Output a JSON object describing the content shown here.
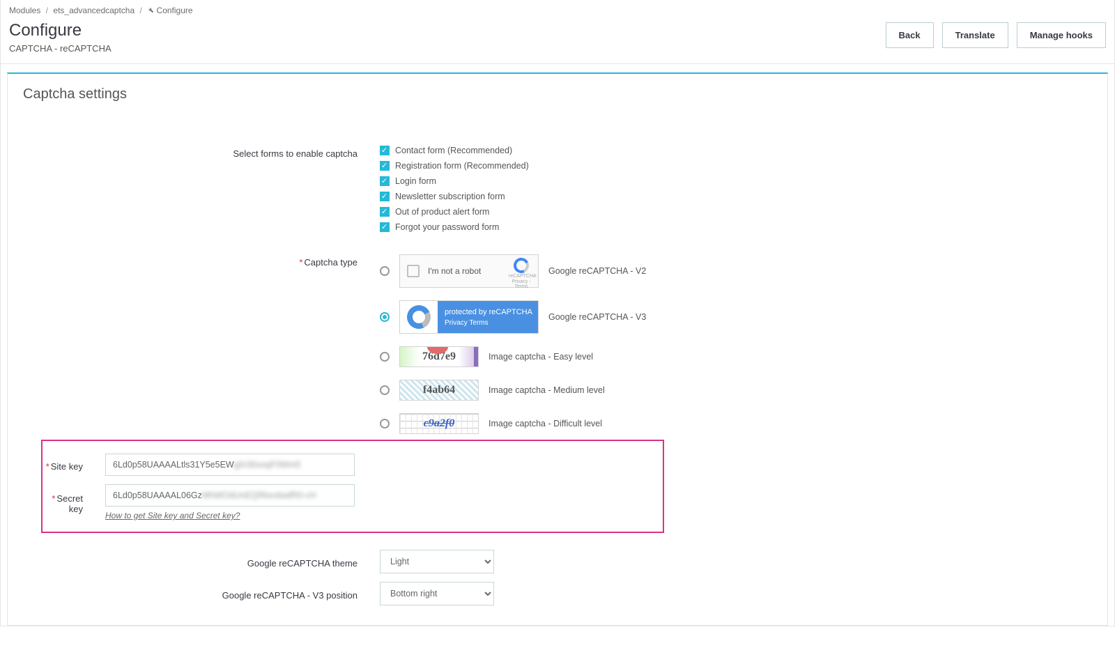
{
  "breadcrumbs": {
    "item1": "Modules",
    "item2": "ets_advancedcaptcha",
    "item3": "Configure"
  },
  "header": {
    "title": "Configure",
    "subtitle": "CAPTCHA - reCAPTCHA",
    "back": "Back",
    "translate": "Translate",
    "manage_hooks": "Manage hooks"
  },
  "panel": {
    "heading": "Captcha settings",
    "forms_label": "Select forms to enable captcha",
    "forms": [
      "Contact form (Recommended)",
      "Registration form (Recommended)",
      "Login form",
      "Newsletter subscription form",
      "Out of product alert form",
      "Forgot your password form"
    ],
    "captcha_type_label": "Captcha type",
    "v2_not_robot": "I'm not a robot",
    "v2_logo_line1": "reCAPTCHA",
    "v2_logo_line2": "Privacy - Terms",
    "v2_label": "Google reCAPTCHA - V2",
    "v3_protected": "protected by reCAPTCHA",
    "v3_privacy": "Privacy   Terms",
    "v3_label": "Google reCAPTCHA - V3",
    "img_easy_sample": "76d7e9",
    "img_easy_label": "Image captcha - Easy level",
    "img_medium_sample": "f4ab64",
    "img_medium_label": "Image captcha - Medium level",
    "img_hard_sample": "c9a2f0",
    "img_hard_label": "Image captcha - Difficult level",
    "site_key_label": "Site key",
    "site_key_value_visible": "6Ld0p58UAAAALtls31Y5e5EW",
    "site_key_value_obscured": "g0r30xoqF0Wm5",
    "secret_key_label": "Secret key",
    "secret_key_value_visible": "6Ld0p58UAAAAL06Gz",
    "secret_key_value_obscured": "MhWOdUnEQRkexbiafR0-cH",
    "help_link": "How to get Site key and Secret key?",
    "theme_label": "Google reCAPTCHA theme",
    "theme_value": "Light",
    "position_label": "Google reCAPTCHA - V3 position",
    "position_value": "Bottom right"
  }
}
